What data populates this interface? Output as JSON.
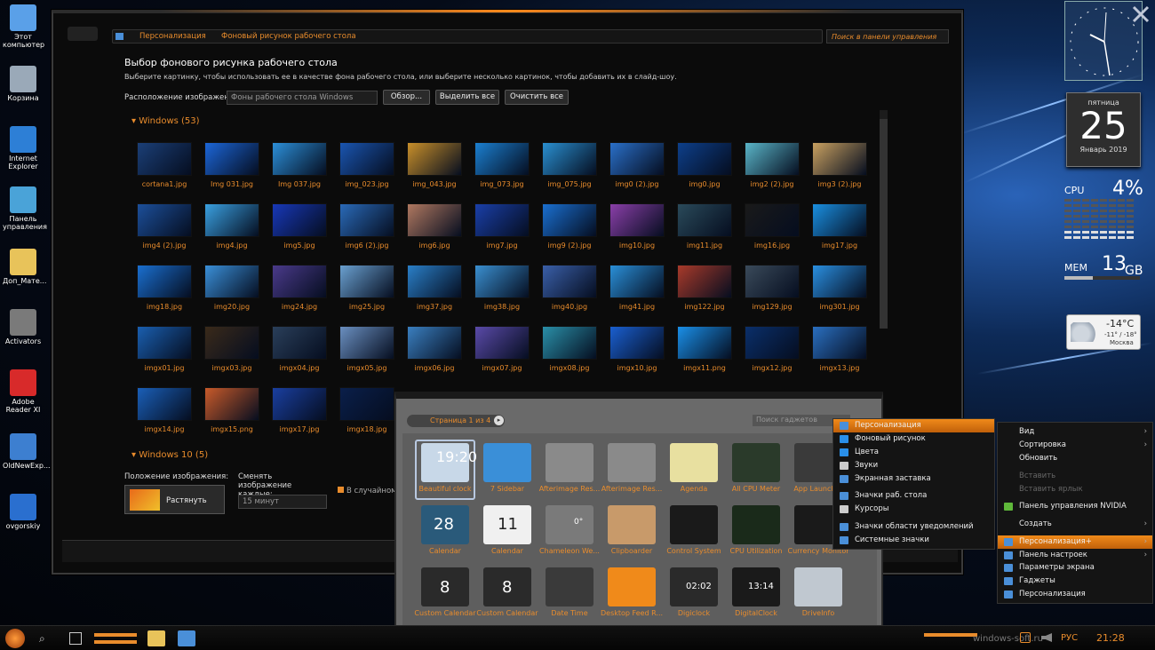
{
  "desktop_icons": [
    {
      "label": "Этот компьютер",
      "color": "#5aa0e8"
    },
    {
      "label": "Корзина",
      "color": "#9aa9b8"
    },
    {
      "label": "Internet Explorer",
      "color": "#2d7fd6"
    },
    {
      "label": "Панель управления",
      "color": "#4aa3d8"
    },
    {
      "label": "Доп_Мате...",
      "color": "#e8c35a"
    },
    {
      "label": "Activators",
      "color": "#7a7a7a"
    },
    {
      "label": "Adobe Reader XI",
      "color": "#d82a2a"
    },
    {
      "label": "OldNewExp...",
      "color": "#3d7fd0"
    },
    {
      "label": "ovgorskiy",
      "color": "#2a6fcf"
    }
  ],
  "window": {
    "breadcrumb": [
      "Персонализация",
      "Фоновый рисунок рабочего стола"
    ],
    "search_placeholder": "Поиск в панели управления",
    "heading": "Выбор фонового рисунка рабочего стола",
    "description": "Выберите картинку, чтобы использовать ее в качестве фона рабочего стола, или выберите несколько картинок, чтобы добавить их в слайд-шоу.",
    "location_label": "Расположение изображения:",
    "location_value": "Фоны рабочего стола Windows",
    "browse_button": "Обзор...",
    "select_all_button": "Выделить все",
    "clear_all_button": "Очистить все",
    "group_windows": "Windows (53)",
    "group_windows10": "Windows 10 (5)",
    "position_label": "Положение изображения:",
    "position_value": "Растянуть",
    "interval_label": "Сменять изображение каждые:",
    "interval_value": "15 минут",
    "shuffle_label": "В случайном"
  },
  "thumbnails": [
    {
      "label": "cortana1.jpg",
      "color": "#1b3f77"
    },
    {
      "label": "Img 031.jpg",
      "color": "#1c66d8"
    },
    {
      "label": "Img 037.jpg",
      "color": "#2c8fd8"
    },
    {
      "label": "img_023.jpg",
      "color": "#1a55b0"
    },
    {
      "label": "img_043.jpg",
      "color": "#c88f2a"
    },
    {
      "label": "img_073.jpg",
      "color": "#1b7fd0"
    },
    {
      "label": "img_075.jpg",
      "color": "#2a8fd0"
    },
    {
      "label": "img0 (2).jpg",
      "color": "#2a6fc8"
    },
    {
      "label": "img0.jpg",
      "color": "#0d3f8a"
    },
    {
      "label": "img2 (2).jpg",
      "color": "#5ab5c8"
    },
    {
      "label": "img3 (2).jpg",
      "color": "#c8a060"
    },
    {
      "label": "img4 (2).jpg",
      "color": "#1c4f9a"
    },
    {
      "label": "img4.jpg",
      "color": "#3aa0e0"
    },
    {
      "label": "img5.jpg",
      "color": "#1838b8"
    },
    {
      "label": "img6 (2).jpg",
      "color": "#2a6ab8"
    },
    {
      "label": "img6.jpg",
      "color": "#b07860"
    },
    {
      "label": "img7.jpg",
      "color": "#1a3fa8"
    },
    {
      "label": "img9 (2).jpg",
      "color": "#1a6fd0"
    },
    {
      "label": "img10.jpg",
      "color": "#8a3fa8"
    },
    {
      "label": "img11.jpg",
      "color": "#2a4a5a"
    },
    {
      "label": "img16.jpg",
      "color": "#1a1a1a"
    },
    {
      "label": "img17.jpg",
      "color": "#1a8fe0"
    },
    {
      "label": "img18.jpg",
      "color": "#1a6fd0"
    },
    {
      "label": "img20.jpg",
      "color": "#3a8fd8"
    },
    {
      "label": "img24.jpg",
      "color": "#4a3a8a"
    },
    {
      "label": "img25.jpg",
      "color": "#6aa0d0"
    },
    {
      "label": "img37.jpg",
      "color": "#2a7fc8"
    },
    {
      "label": "img38.jpg",
      "color": "#3a8fd0"
    },
    {
      "label": "img40.jpg",
      "color": "#3a5fa8"
    },
    {
      "label": "img41.jpg",
      "color": "#2a8fd8"
    },
    {
      "label": "img122.jpg",
      "color": "#a83a2a"
    },
    {
      "label": "img129.jpg",
      "color": "#3a4a5a"
    },
    {
      "label": "img301.jpg",
      "color": "#2a8fe0"
    },
    {
      "label": "imgx01.jpg",
      "color": "#1a5fb0"
    },
    {
      "label": "imgx03.jpg",
      "color": "#3a2a1a"
    },
    {
      "label": "imgx04.jpg",
      "color": "#2a3f5a"
    },
    {
      "label": "imgx05.jpg",
      "color": "#6a8fc0"
    },
    {
      "label": "imgx06.jpg",
      "color": "#3a7fc0"
    },
    {
      "label": "imgx07.jpg",
      "color": "#5a4aa8"
    },
    {
      "label": "imgx08.jpg",
      "color": "#2a8fa8"
    },
    {
      "label": "imgx10.jpg",
      "color": "#1a5fd0"
    },
    {
      "label": "imgx11.png",
      "color": "#1a8fe8"
    },
    {
      "label": "imgx12.jpg",
      "color": "#0a2f6a"
    },
    {
      "label": "imgx13.jpg",
      "color": "#2a6fc0"
    },
    {
      "label": "imgx14.jpg",
      "color": "#1a5fb8"
    },
    {
      "label": "imgx15.png",
      "color": "#c85a2a"
    },
    {
      "label": "imgx17.jpg",
      "color": "#1a3fa0"
    },
    {
      "label": "imgx18.jpg",
      "color": "#0a1f4a"
    }
  ],
  "gadget_gallery": {
    "pager": "Страница 1 из 4",
    "search": "Поиск гаджетов",
    "items": [
      {
        "label": "Beautiful clock",
        "color": "#c8d8e8"
      },
      {
        "label": "7 Sidebar",
        "color": "#3a8fd8"
      },
      {
        "label": "Afterimage Res...",
        "color": "#8a8a8a"
      },
      {
        "label": "Afterimage Res...",
        "color": "#8a8a8a"
      },
      {
        "label": "Agenda",
        "color": "#e8e0a0"
      },
      {
        "label": "All CPU Meter",
        "color": "#2a3a2a"
      },
      {
        "label": "App Launcher",
        "color": "#3a3a3a"
      },
      {
        "label": "Calendar",
        "color": "#2a5a7a"
      },
      {
        "label": "Calendar",
        "color": "#f0f0f0"
      },
      {
        "label": "Chameleon We...",
        "color": "#7a7a7a"
      },
      {
        "label": "Clipboarder",
        "color": "#c89a6a"
      },
      {
        "label": "Control System",
        "color": "#1a1a1a"
      },
      {
        "label": "CPU Utilization",
        "color": "#1a2a1a"
      },
      {
        "label": "Currency Monitor",
        "color": "#1a1a1a"
      },
      {
        "label": "Custom Calendar",
        "color": "#2a2a2a"
      },
      {
        "label": "Custom Calendar",
        "color": "#2a2a2a"
      },
      {
        "label": "Date Time",
        "color": "#3a3a3a"
      },
      {
        "label": "Desktop Feed R...",
        "color": "#f08a1a"
      },
      {
        "label": "Digiclock",
        "color": "#2a2a2a"
      },
      {
        "label": "DigitalClock",
        "color": "#1a1a1a"
      },
      {
        "label": "DriveInfo",
        "color": "#c0c8d0"
      }
    ],
    "texts": {
      "clock": "19:20",
      "cal1_num": "28",
      "cal2_num": "11",
      "cc1": "8",
      "cc2": "8",
      "digi": "02:02",
      "digital": "13:14",
      "cham": "0°"
    }
  },
  "context_menu_desktop": {
    "items": [
      {
        "label": "Вид",
        "arrow": true
      },
      {
        "label": "Сортировка",
        "arrow": true
      },
      {
        "label": "Обновить"
      },
      {
        "label": "Вставить",
        "disabled": true
      },
      {
        "label": "Вставить ярлык",
        "disabled": true
      },
      {
        "label": "Панель управления NVIDIA",
        "icon": "#5fb83a"
      },
      {
        "label": "Создать",
        "arrow": true
      },
      {
        "label": "Персонализация+",
        "arrow": true,
        "highlight": true,
        "icon": "#4a8fd8"
      },
      {
        "label": "Панель настроек",
        "arrow": true,
        "icon": "#4a8fd8"
      },
      {
        "label": "Параметры экрана",
        "icon": "#4a8fd8"
      },
      {
        "label": "Гаджеты",
        "icon": "#4a8fd8"
      },
      {
        "label": "Персонализация",
        "icon": "#4a8fd8"
      }
    ]
  },
  "context_menu_submenu": {
    "items": [
      {
        "label": "Персонализация",
        "highlight": true,
        "icon": "#4a8fd8"
      },
      {
        "label": "Фоновый рисунок",
        "icon": "#2a8fe8"
      },
      {
        "label": "Цвета",
        "icon": "#2a8fe8"
      },
      {
        "label": "Звуки",
        "icon": "#cccccc"
      },
      {
        "label": "Экранная заставка",
        "icon": "#4a8fd8"
      },
      {
        "label": "Значки раб. стола",
        "icon": "#4a8fd8"
      },
      {
        "label": "Курсоры",
        "icon": "#cccccc"
      },
      {
        "label": "Значки области уведомлений",
        "icon": "#4a8fd8"
      },
      {
        "label": "Системные значки",
        "icon": "#4a8fd8"
      }
    ]
  },
  "gadgets": {
    "day_name": "пятница",
    "day_num": "25",
    "month_year": "Январь 2019",
    "cpu_label": "CPU",
    "cpu_value": "4%",
    "mem_label": "MEM",
    "mem_value": "13",
    "mem_unit": "GB",
    "temp": "-14°C",
    "temp_range": "-11° / -18°",
    "city": "Москва"
  },
  "taskbar": {
    "lang": "РУС",
    "time": "21:28",
    "watermark": "windows-soft.ru"
  },
  "colors": {
    "accent": "#e98c2c",
    "window_bg": "#0b0b0b"
  }
}
